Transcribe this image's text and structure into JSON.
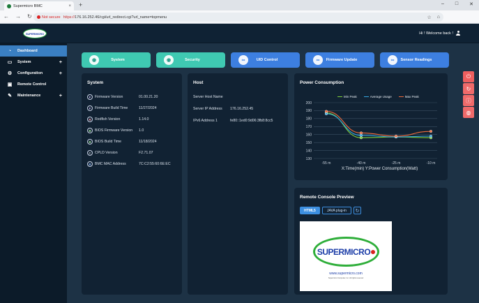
{
  "browser": {
    "tab_title": "Supermicro BMC",
    "tab_close": "×",
    "new_tab": "+",
    "security_label": "Not secure",
    "url_scheme": "https://",
    "url_rest": "176.16.252.46/cgi/url_redirect.cgi?url_name=topmenu"
  },
  "header": {
    "logo_text": "SUPERMICRO",
    "welcome": "Hi ! Welcome back !"
  },
  "sidebar": {
    "items": [
      {
        "label": "Dashboard",
        "icon": "speedometer-icon"
      },
      {
        "label": "System",
        "icon": "monitor-icon",
        "plus": "+"
      },
      {
        "label": "Configuration",
        "icon": "gear-icon",
        "plus": "+"
      },
      {
        "label": "Remote Control",
        "icon": "remote-desktop-icon"
      },
      {
        "label": "Maintenance",
        "icon": "wrench-icon",
        "plus": "+"
      }
    ]
  },
  "quick_buttons": [
    {
      "label": "System",
      "icon": "system-icon",
      "color": "#3fc9b2"
    },
    {
      "label": "Security",
      "icon": "security-icon",
      "color": "#3fc9b2"
    },
    {
      "label": "UID Control",
      "icon": "link-icon",
      "color": "#3d7fe0"
    },
    {
      "label": "Firmware Update",
      "icon": "link-icon",
      "color": "#3d7fe0"
    },
    {
      "label": "Sensor Readings",
      "icon": "link-icon",
      "color": "#3d7fe0"
    }
  ],
  "system_panel": {
    "title": "System",
    "rows": [
      {
        "badge": "F",
        "label": "Firmware Version",
        "value": "01.00.21.20"
      },
      {
        "badge": "F",
        "label": "Firmware Build Time",
        "value": "11/27/2024"
      },
      {
        "badge": "R",
        "label": "Redfish Version",
        "value": "1.14.0"
      },
      {
        "badge": "B",
        "label": "BIOS Firmware Version",
        "value": "1.0"
      },
      {
        "badge": "B",
        "label": "BIOS Build Time",
        "value": "11/18/2024"
      },
      {
        "badge": "C",
        "label": "CPLD Version",
        "value": "F2.71.07"
      },
      {
        "badge": "B",
        "label": "BMC MAC Address",
        "value": "7C:C2:55:60:6E:EC"
      }
    ]
  },
  "host_panel": {
    "title": "Host",
    "rows": [
      {
        "label": "Server Host Name",
        "value": ""
      },
      {
        "label": "Server IP Address",
        "value": "176.16.252.45"
      },
      {
        "label": "IPv6 Address 1",
        "value": "fe80::1ed0:9d06:3fb8:8cc5"
      }
    ]
  },
  "power_panel": {
    "title": "Power Consumption"
  },
  "chart_data": {
    "type": "line",
    "title": "",
    "xlabel": "X:Time(min) Y:Power Consumption(Watt)",
    "ylabel": "",
    "categories": [
      "-55 m",
      "-40 m",
      "-25 m",
      "-10 m"
    ],
    "ylim": [
      130,
      200
    ],
    "yticks": [
      130,
      140,
      150,
      160,
      170,
      180,
      190,
      200
    ],
    "legend_position": "top",
    "grid": true,
    "series": [
      {
        "name": "Min Peak",
        "color": "#7fcf3a",
        "values": [
          187,
          156,
          157,
          156
        ]
      },
      {
        "name": "Average Usage",
        "color": "#36a7e0",
        "values": [
          186,
          159,
          157,
          158
        ]
      },
      {
        "name": "Max Peak",
        "color": "#f06a3a",
        "values": [
          189,
          162,
          158,
          164
        ]
      }
    ]
  },
  "remote_panel": {
    "title": "Remote Console Preview",
    "html5_label": "HTML5",
    "java_label": "JAVA plug-in",
    "preview_logo": "SUPERMICRO",
    "preview_url": "www.supermicro.com",
    "preview_small": "Supermicro Computer, Inc. All rights reserved"
  }
}
